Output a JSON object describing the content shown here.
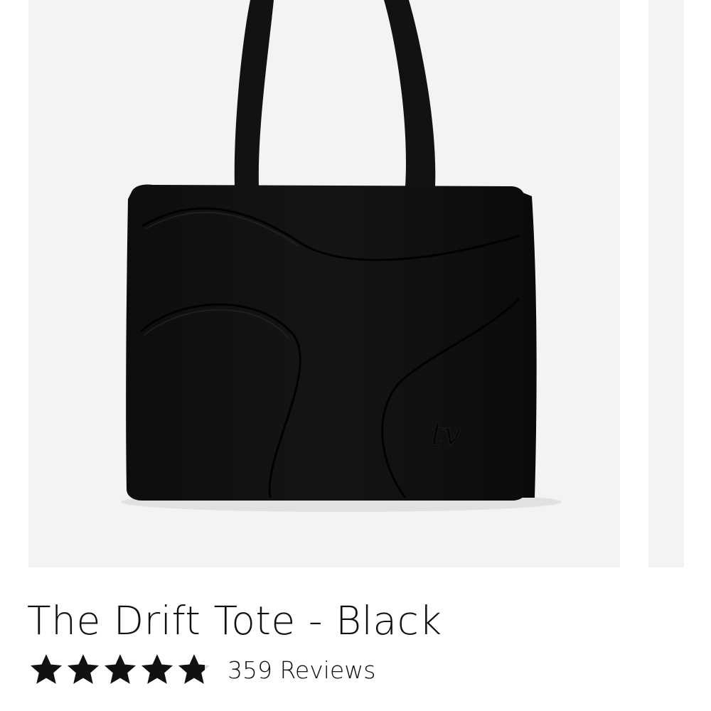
{
  "product": {
    "title": "The Drift Tote - Black",
    "image_alt": "Black quilted puffer tote bag",
    "logo_mark": "tv"
  },
  "rating": {
    "stars_out_of_5": 4.8,
    "max_stars": 5,
    "reviews_label": "359 Reviews"
  },
  "colors": {
    "image_background": "#f3f3f3",
    "bag": "#111111",
    "text": "#111111",
    "star": "#111111"
  },
  "icons": {
    "rating": "star-icon"
  }
}
